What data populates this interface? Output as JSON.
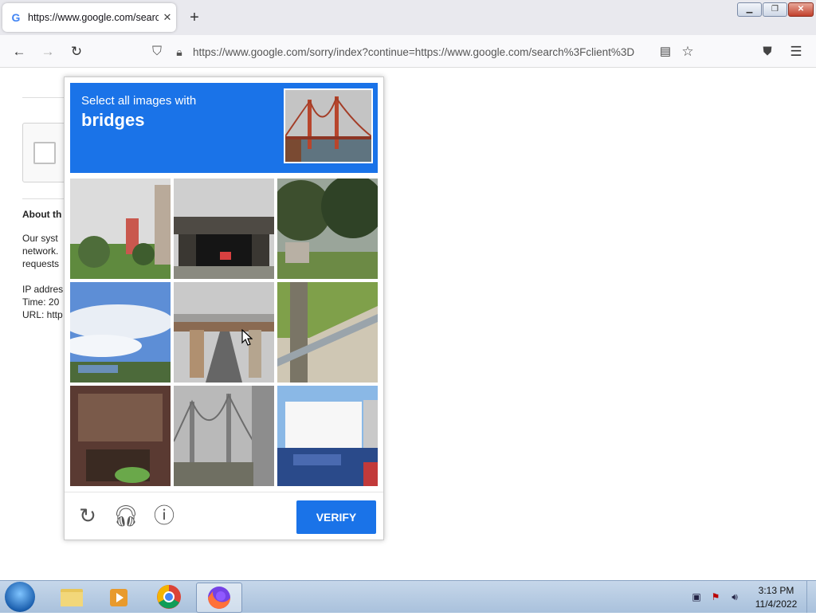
{
  "browser": {
    "tab": {
      "title": "https://www.google.com/search?client"
    },
    "url": "https://www.google.com/sorry/index?continue=https://www.google.com/search%3Fclient%3D"
  },
  "page": {
    "about_heading": "About th",
    "body_lines": [
      "Our syst",
      "network.",
      "requests"
    ],
    "info_lines": [
      "IP addres",
      "Time: 20",
      "URL: http"
    ]
  },
  "captcha": {
    "instruction": "Select all images with",
    "target": "bridges",
    "verify_label": "VERIFY",
    "tiles": [
      {
        "id": "1",
        "desc": "buildings-trees"
      },
      {
        "id": "2",
        "desc": "underpass-bridge"
      },
      {
        "id": "3",
        "desc": "trees-field"
      },
      {
        "id": "4",
        "desc": "sky-clouds"
      },
      {
        "id": "5",
        "desc": "road-overpass"
      },
      {
        "id": "6",
        "desc": "guardrail-grass"
      },
      {
        "id": "7",
        "desc": "room-interior"
      },
      {
        "id": "8",
        "desc": "suspension-bridge"
      },
      {
        "id": "9",
        "desc": "car-billboard"
      }
    ]
  },
  "taskbar": {
    "time": "3:13 PM",
    "date": "11/4/2022"
  },
  "colors": {
    "accent": "#1a73e8"
  }
}
